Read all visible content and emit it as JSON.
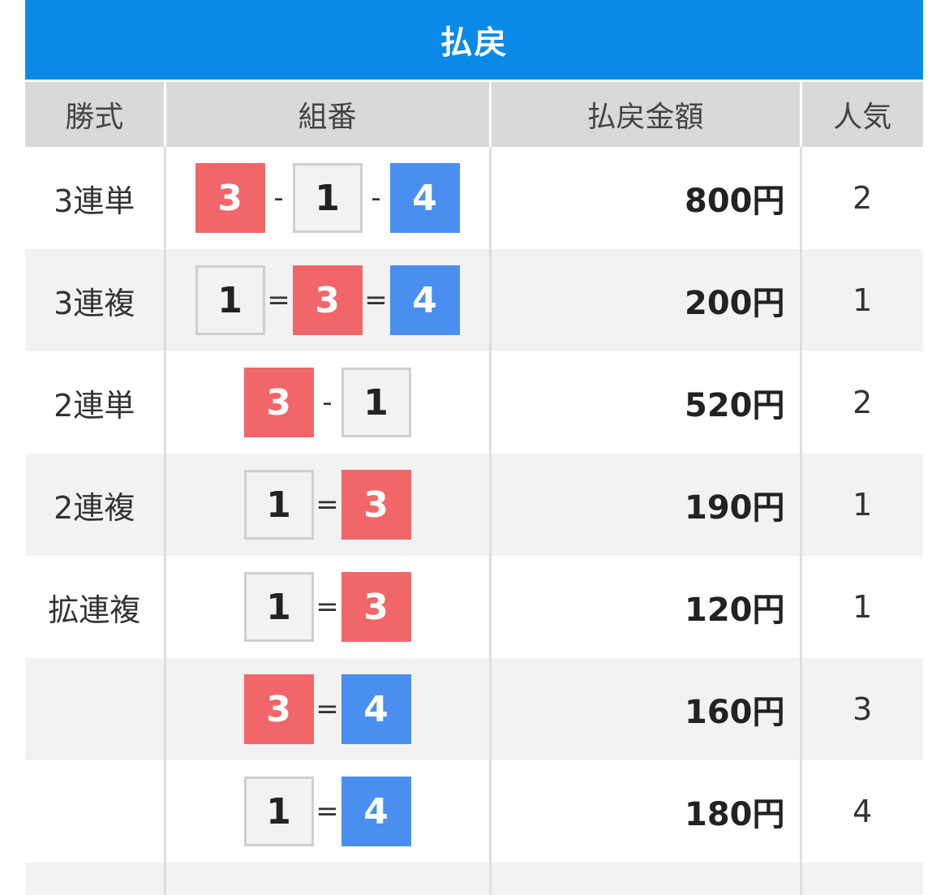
{
  "title": "払戻",
  "headers": {
    "kind": "勝式",
    "combo": "組番",
    "amount": "払戻金額",
    "popularity": "人気"
  },
  "boat_colors": {
    "1": "#f2f2f2",
    "3": "#f06669",
    "4": "#4a8ef0"
  },
  "rows": [
    {
      "kind": "3連単",
      "combo": [
        "3",
        "-",
        "1",
        "-",
        "4"
      ],
      "amount": "800円",
      "popularity": "2"
    },
    {
      "kind": "3連複",
      "combo": [
        "1",
        "=",
        "3",
        "=",
        "4"
      ],
      "amount": "200円",
      "popularity": "1"
    },
    {
      "kind": "2連単",
      "combo": [
        "3",
        "-",
        "1"
      ],
      "amount": "520円",
      "popularity": "2"
    },
    {
      "kind": "2連複",
      "combo": [
        "1",
        "=",
        "3"
      ],
      "amount": "190円",
      "popularity": "1"
    },
    {
      "kind": "拡連複",
      "combo": [
        "1",
        "=",
        "3"
      ],
      "amount": "120円",
      "popularity": "1"
    },
    {
      "kind": "",
      "combo": [
        "3",
        "=",
        "4"
      ],
      "amount": "160円",
      "popularity": "3"
    },
    {
      "kind": "",
      "combo": [
        "1",
        "=",
        "4"
      ],
      "amount": "180円",
      "popularity": "4"
    }
  ]
}
